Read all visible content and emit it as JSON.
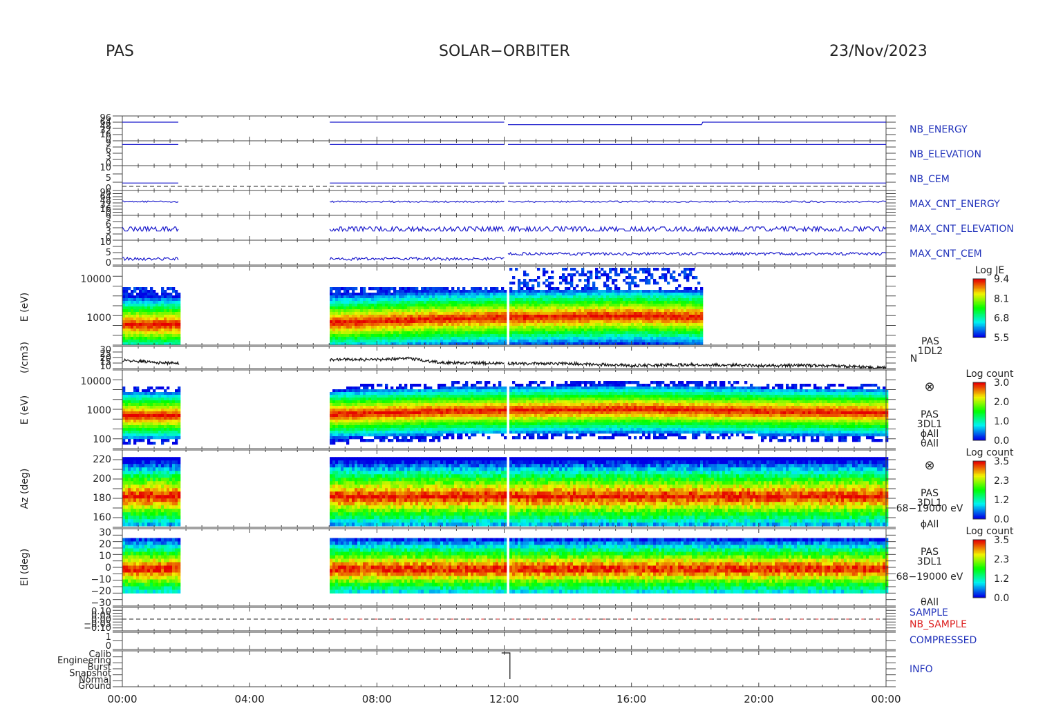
{
  "header": {
    "left": "PAS",
    "center": "SOLAR−ORBITER",
    "right": "23/Nov/2023"
  },
  "x_ticks": [
    "00:00",
    "04:00",
    "08:00",
    "12:00",
    "16:00",
    "20:00",
    "00:00"
  ],
  "colors": {
    "blue_label": "#2233bb",
    "red_label": "#dd2222",
    "trace": "#1a1acc"
  },
  "panels": {
    "nb_energy": {
      "label": "NB_ENERGY",
      "ticks": [
        "96",
        "64",
        "48",
        "32",
        "16",
        "0"
      ]
    },
    "nb_elevation": {
      "label": "NB_ELEVATION",
      "ticks": [
        "9",
        "6",
        "3",
        "0"
      ]
    },
    "nb_cem": {
      "label": "NB_CEM",
      "ticks": [
        "10",
        "5",
        "0"
      ]
    },
    "max_cnt_energy": {
      "label": "MAX_CNT_ENERGY",
      "ticks": [
        "96",
        "64",
        "48",
        "32",
        "16",
        "0"
      ]
    },
    "max_cnt_elevation": {
      "label": "MAX_CNT_ELEVATION",
      "ticks": [
        "9",
        "6",
        "3",
        "0"
      ]
    },
    "max_cnt_cem": {
      "label": "MAX_CNT_CEM",
      "ticks": [
        "10",
        "5",
        "0"
      ]
    },
    "energy_l2": {
      "ylabel": "E (eV)",
      "ticks": [
        "10000",
        "1000"
      ],
      "title_lines": [
        "PAS"
      ],
      "colorbar": {
        "title": "Log JE",
        "ticks": [
          "9.4",
          "8.1",
          "6.8",
          "5.5"
        ]
      }
    },
    "density": {
      "ylabel": "(/cm3)",
      "ticks": [
        "30",
        "25",
        "20",
        "15",
        "10"
      ],
      "labels": [
        "PAS",
        "1DL2",
        "N"
      ]
    },
    "energy_l1": {
      "ylabel": "E (eV)",
      "ticks": [
        "10000",
        "1000",
        "100"
      ],
      "labels": [
        "PAS",
        "3DL1",
        "ϕAll",
        "θAll"
      ],
      "symbol": "⊗",
      "colorbar": {
        "title": "Log count",
        "ticks": [
          "3.0",
          "2.0",
          "1.0",
          "0.0"
        ]
      }
    },
    "azimuth": {
      "ylabel": "Az (deg)",
      "ticks": [
        "220",
        "200",
        "180",
        "160"
      ],
      "labels": [
        "PAS",
        "3DL1",
        "68−19000 eV",
        "ϕAll"
      ],
      "symbol": "⊗",
      "colorbar": {
        "title": "Log count",
        "ticks": [
          "3.5",
          "2.3",
          "1.2",
          "0.0"
        ]
      }
    },
    "elevation": {
      "ylabel": "El (deg)",
      "ticks": [
        "30",
        "20",
        "10",
        "0",
        "−10",
        "−20",
        "−30"
      ],
      "labels": [
        "PAS",
        "3DL1",
        "68−19000 eV",
        "θAll"
      ],
      "colorbar": {
        "title": "Log count",
        "ticks": [
          "3.5",
          "2.3",
          "1.2",
          "0.0"
        ]
      }
    },
    "sample": {
      "label": "SAMPLE",
      "label2": "NB_SAMPLE",
      "ticks": [
        "0.10",
        "0.05",
        "0.00",
        "−0.05",
        "−0.10"
      ]
    },
    "compressed": {
      "label": "COMPRESSED",
      "ticks": [
        "1",
        "0"
      ]
    },
    "info": {
      "label": "INFO",
      "ticks": [
        "Calib",
        "Engineering",
        "Burst",
        "Snapshot",
        "Normal",
        "Ground"
      ]
    }
  },
  "chart_data": {
    "type": "heatmap",
    "title": "SOLAR−ORBITER",
    "date": "23/Nov/2023",
    "x_range": [
      "00:00",
      "24:00"
    ],
    "data_intervals_hours": [
      [
        0.0,
        1.8
      ],
      [
        6.5,
        12.0
      ],
      [
        12.1,
        24.0
      ]
    ],
    "energy_l2_intervals_hours": [
      [
        0.0,
        1.8
      ],
      [
        6.5,
        12.0
      ],
      [
        12.1,
        18.2
      ]
    ],
    "energy_peak_eV": [
      {
        "t": 0.5,
        "e": 700
      },
      {
        "t": 7.0,
        "e": 800
      },
      {
        "t": 10.0,
        "e": 1000
      },
      {
        "t": 13.0,
        "e": 1100
      },
      {
        "t": 16.0,
        "e": 1200
      },
      {
        "t": 20.0,
        "e": 1000
      },
      {
        "t": 23.5,
        "e": 900
      }
    ],
    "density_cm3": [
      {
        "t": 0.2,
        "n": 17
      },
      {
        "t": 1.0,
        "n": 15
      },
      {
        "t": 1.8,
        "n": 14
      },
      {
        "t": 6.5,
        "n": 18
      },
      {
        "t": 8.0,
        "n": 18
      },
      {
        "t": 9.0,
        "n": 19
      },
      {
        "t": 10.0,
        "n": 15
      },
      {
        "t": 12.0,
        "n": 14
      },
      {
        "t": 14.0,
        "n": 14
      },
      {
        "t": 16.0,
        "n": 12
      },
      {
        "t": 18.0,
        "n": 13
      },
      {
        "t": 20.0,
        "n": 12
      },
      {
        "t": 22.0,
        "n": 12
      },
      {
        "t": 24.0,
        "n": 10
      }
    ],
    "azimuth_peak_deg": 183,
    "elevation_peak_deg": 0,
    "info_mode_change": {
      "t": 12.05,
      "from": "Burst",
      "to": "Normal"
    }
  }
}
